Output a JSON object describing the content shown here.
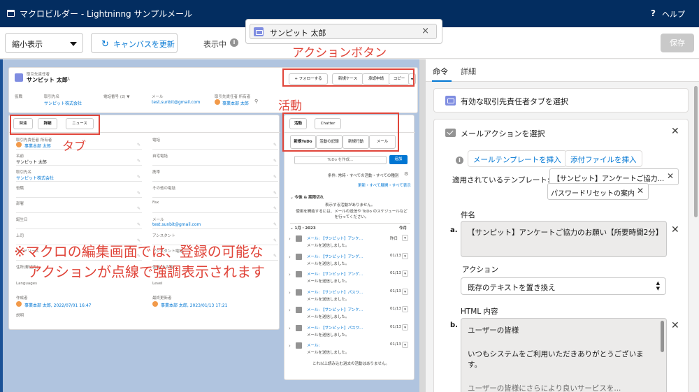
{
  "app": {
    "title": "マクロビルダー - Lightninng サンプルメール",
    "help_label": "ヘルプ",
    "help_icon": "?"
  },
  "toolbar": {
    "zoom_select": "縮小表示",
    "refresh_label": "キャンバスを更新",
    "view_label": "表示中",
    "info_glyph": "i",
    "contact_pill": "サンピット 太郎",
    "save_label": "保存"
  },
  "record": {
    "object_label": "取引先責任者",
    "name": "サンピット 太郎",
    "action_buttons": [
      "+ フォローする",
      "新規ケース",
      "承認申請",
      "コピー"
    ],
    "highlights": [
      {
        "label": "役職",
        "value": ""
      },
      {
        "label": "取引先名",
        "value": "サンピット株式会社"
      },
      {
        "label": "電話番号 (2) ▼",
        "value": ""
      },
      {
        "label": "メール",
        "value": "test.sunbit@gmail.com"
      },
      {
        "label": "取引先責任者 所有者",
        "value": "事業本部 太郎"
      }
    ],
    "tabs": [
      "関連",
      "詳細",
      "ニュース"
    ],
    "left_fields": [
      {
        "label": "取引先責任者 所有者",
        "value": "事業本部 太郎",
        "link": true
      },
      {
        "label": "名前",
        "value": "サンピット 太郎",
        "link": false
      },
      {
        "label": "取引先名",
        "value": "サンピット株式会社",
        "link": true
      },
      {
        "label": "役職",
        "value": "",
        "link": false
      },
      {
        "label": "部署",
        "value": "",
        "link": false
      },
      {
        "label": "誕生日",
        "value": "",
        "link": false
      },
      {
        "label": "上司",
        "value": "",
        "link": false
      },
      {
        "label": "リードソース",
        "value": "",
        "link": false
      }
    ],
    "right_fields": [
      {
        "label": "電話",
        "value": "",
        "link": false
      },
      {
        "label": "自宅電話",
        "value": "",
        "link": false
      },
      {
        "label": "携帯",
        "value": "",
        "link": false
      },
      {
        "label": "その他の電話",
        "value": "",
        "link": false
      },
      {
        "label": "Fax",
        "value": "",
        "link": false
      },
      {
        "label": "メール",
        "value": "test.sunbit@gmail.com",
        "link": true
      },
      {
        "label": "アシスタント",
        "value": "",
        "link": false
      },
      {
        "label": "アシスタント電話",
        "value": "",
        "link": false
      }
    ],
    "lower_left": [
      {
        "label": "住所(郵送先)",
        "value": ""
      },
      {
        "label": "Languages",
        "value": ""
      }
    ],
    "lower_right": [
      {
        "label": "住所(その他)",
        "value": ""
      },
      {
        "label": "Level",
        "value": ""
      }
    ],
    "created_label": "作成者",
    "created_value": "事業本部 太郎, 2022/07/01 16:47",
    "modified_label": "最終更新者",
    "modified_value": "事業本部 太郎, 2023/01/13 17:21",
    "description_label": "説明"
  },
  "activity": {
    "tabs": [
      "活動",
      "Chatter"
    ],
    "subtabs": [
      "新規ToDo",
      "活動の記録",
      "新規行動",
      "メール"
    ],
    "todo_placeholder": "ToDo を作成...",
    "add_button": "追加",
    "filter_text": "条件: 常時・すべての活動・すべての種別",
    "refresh_links": "更新・すべて展開・すべて表示",
    "upcoming_title": "今後 & 期限切れ",
    "no_activity": "表示する活動がありません。",
    "no_activity_hint": "使用を開始するには、メールの送信や ToDo のスケジュールなどを行ってください。",
    "month_label": "1月・2023",
    "month_right": "今月",
    "items": [
      {
        "title": "メール: 【サンピット】アンケ...",
        "date": "昨日",
        "sub": "メールを送信しました。"
      },
      {
        "title": "メール: 【サンピット】アンゲ...",
        "date": "01/13",
        "sub": "メールを送信しました。"
      },
      {
        "title": "メール: 【サンピット】アンゲ...",
        "date": "01/13",
        "sub": "メールを送信しました。"
      },
      {
        "title": "メール: 【サンピット】パスワ...",
        "date": "01/13",
        "sub": "メールを送信しました。"
      },
      {
        "title": "メール: 【サンピット】アンケ...",
        "date": "01/13",
        "sub": "メールを送信しました。"
      },
      {
        "title": "メール: 【サンピット】パスワ...",
        "date": "01/13",
        "sub": "メールを送信しました。"
      },
      {
        "title": "メール:",
        "date": "01/13",
        "sub": "メールを送信しました。"
      }
    ],
    "footer": "これ以上読み込む過去の活動はありません。"
  },
  "annotations": {
    "action_button": "アクションボタン",
    "tabs": "タブ",
    "activity": "活動",
    "note_line1": "※マクロの編集画面では、登録の可能な",
    "note_line2": "アクションが点線で強調表示されます"
  },
  "panel": {
    "tabs": [
      "命令",
      "詳細"
    ],
    "step1": "有効な取引先責任者タブを選択",
    "step2": "メールアクションを選択",
    "insert_template": "メールテンプレートを挿入",
    "insert_file": "添付ファイルを挿入",
    "applied_label": "適用されているテンプレート:",
    "templates": [
      "【サンピット】アンケートご協力...",
      "パスワードリセットの案内"
    ],
    "subject_label": "件名",
    "marker_a": "a.",
    "subject_value": "【サンピット】アンケートご協力のお願い【所要時間2分】",
    "action_label": "アクション",
    "action_value": "既存のテキストを置き換え",
    "html_label": "HTML 内容",
    "marker_b": "b.",
    "html_lines": [
      "ユーザーの皆様",
      "いつもシステムをご利用いただきありがとうございます。",
      "ユーザーの皆様にさらにより良いサービスを..."
    ]
  },
  "colors": {
    "header": "#032d60",
    "accent": "#0176d3",
    "annotation": "#e0453a",
    "record_icon": "#7f8de1"
  }
}
